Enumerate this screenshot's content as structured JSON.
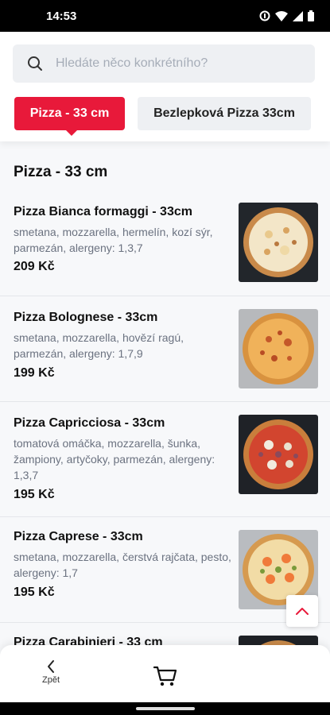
{
  "status_bar": {
    "time": "14:53"
  },
  "search": {
    "placeholder": "Hledáte něco konkrétního?"
  },
  "tabs": [
    {
      "label": "Pizza - 33 cm",
      "active": true
    },
    {
      "label": "Bezlepková Pizza 33cm",
      "active": false
    }
  ],
  "section": {
    "title": "Pizza - 33 cm"
  },
  "items": [
    {
      "name": "Pizza Bianca formaggi - 33cm",
      "description": "smetana, mozzarella, hermelín, kozí sýr, parmezán, alergeny: 1,3,7",
      "price": "209 Kč"
    },
    {
      "name": "Pizza Bolognese - 33cm",
      "description": "smetana, mozzarella, hovězí ragú, parmezán, alergeny: 1,7,9",
      "price": "199 Kč"
    },
    {
      "name": "Pizza Capricciosa - 33cm",
      "description": "tomatová omáčka, mozzarella, šunka, žampiony, artyčoky, parmezán, alergeny: 1,3,7",
      "price": "195 Kč"
    },
    {
      "name": "Pizza Caprese - 33cm",
      "description": "smetana, mozzarella, čerstvá rajčata, pesto, alergeny: 1,7",
      "price": "195 Kč"
    },
    {
      "name": "Pizza Carabinieri - 33 cm"
    }
  ],
  "bottom_bar": {
    "back_label": "Zpět"
  },
  "colors": {
    "accent": "#e8193a",
    "background": "#f7f8fa",
    "search_bg": "#eef0f3"
  },
  "icons": [
    "search-icon",
    "chevron-left-icon",
    "cart-icon",
    "chevron-up-icon",
    "wifi-icon",
    "battery-icon"
  ]
}
